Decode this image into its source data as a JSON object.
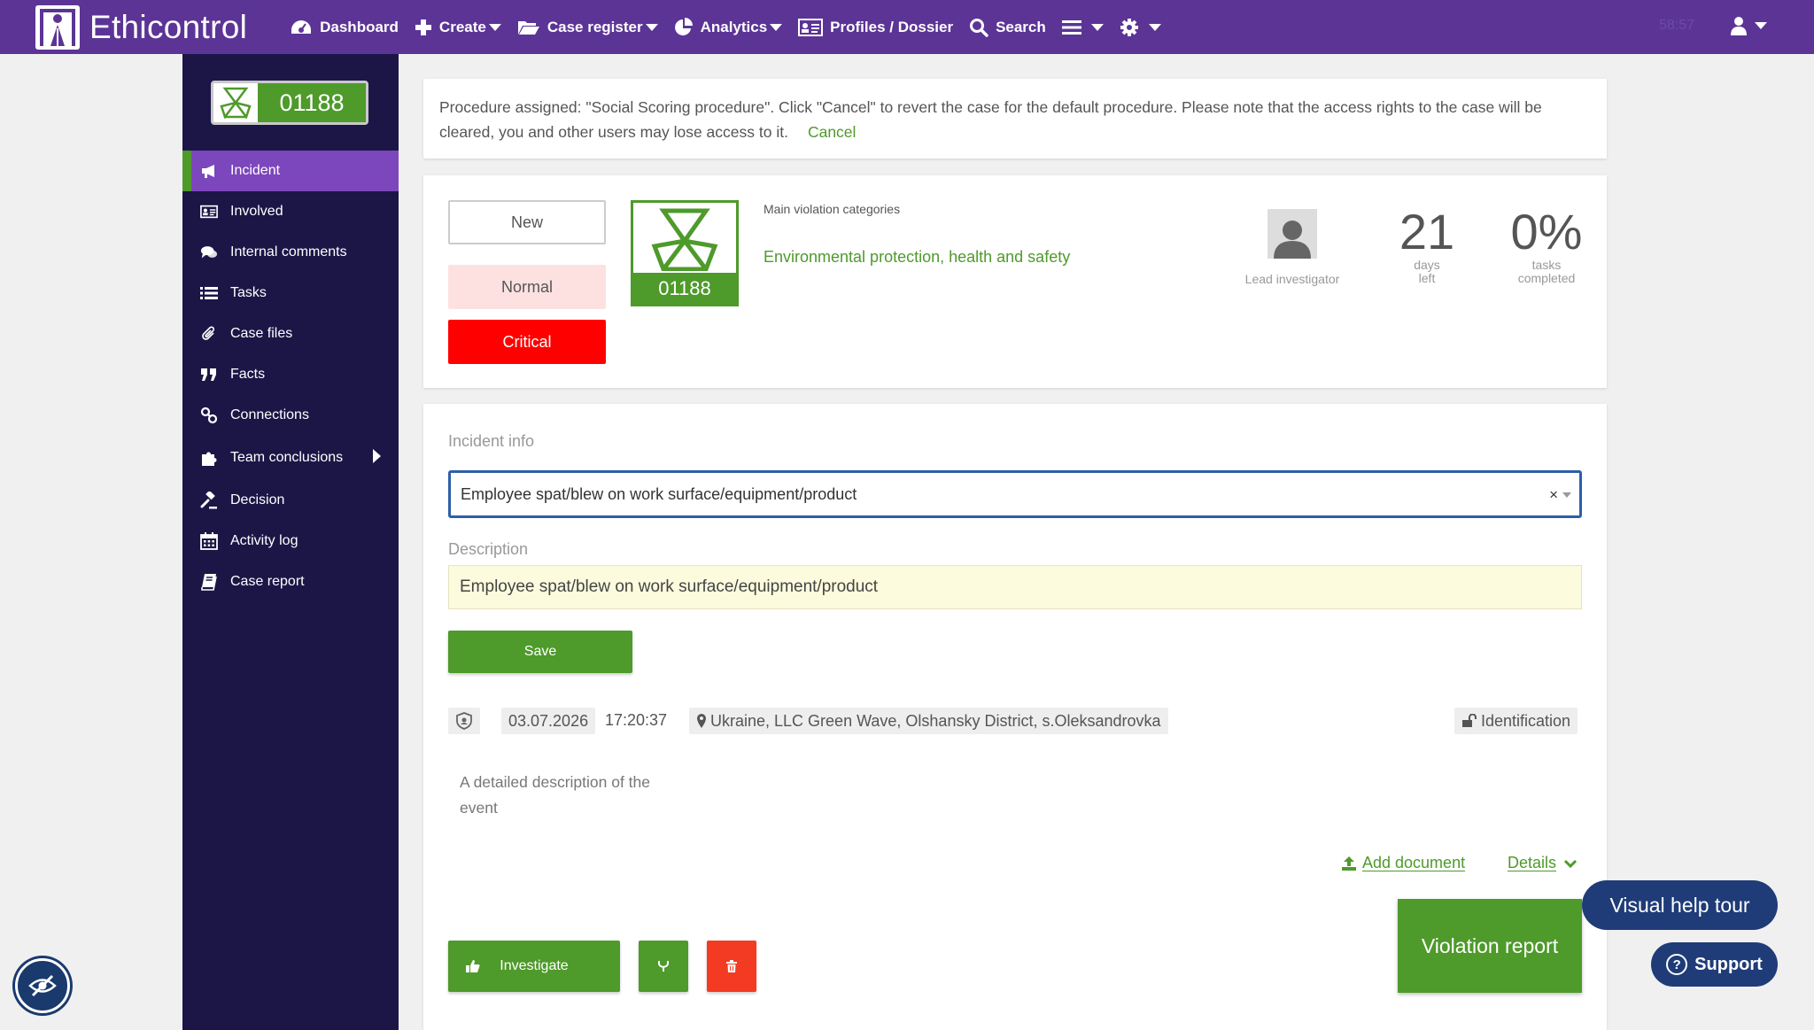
{
  "brand": {
    "name": "Ethicontrol"
  },
  "nav": {
    "items": [
      {
        "label": "Dashboard",
        "dropdown": false
      },
      {
        "label": "Create",
        "dropdown": true
      },
      {
        "label": "Case register",
        "dropdown": true
      },
      {
        "label": "Analytics",
        "dropdown": true
      },
      {
        "label": "Profiles / Dossier",
        "dropdown": false
      },
      {
        "label": "Search",
        "dropdown": false
      }
    ],
    "timer": "58:57"
  },
  "sidebar": {
    "case_number": "01188",
    "items": [
      {
        "label": "Incident",
        "icon": "megaphone-icon",
        "active": true
      },
      {
        "label": "Involved",
        "icon": "id-card-icon"
      },
      {
        "label": "Internal comments",
        "icon": "comments-icon"
      },
      {
        "label": "Tasks",
        "icon": "list-icon"
      },
      {
        "label": "Case files",
        "icon": "paperclip-icon"
      },
      {
        "label": "Facts",
        "icon": "quote-icon"
      },
      {
        "label": "Connections",
        "icon": "link-icon"
      },
      {
        "label": "Team conclusions",
        "icon": "puzzle-icon",
        "has_submenu": true
      },
      {
        "label": "Decision",
        "icon": "gavel-icon"
      },
      {
        "label": "Activity log",
        "icon": "calendar-icon"
      },
      {
        "label": "Case report",
        "icon": "book-icon"
      }
    ]
  },
  "notice": {
    "text": "Procedure assigned: \"Social Scoring procedure\". Click \"Cancel\" to revert the case for the default procedure. Please note that the access rights to the case will be cleared, you and other users may lose access to it.",
    "cancel_label": "Cancel"
  },
  "case": {
    "statuses": {
      "new": "New",
      "normal": "Normal",
      "critical": "Critical"
    },
    "number": "01188",
    "category_label": "Main violation categories",
    "category_value": "Environmental protection, health and safety",
    "investigator_label": "Lead investigator",
    "days_left": {
      "value": "21",
      "label_line1": "days",
      "label_line2": "left"
    },
    "tasks": {
      "value": "0%",
      "label_line1": "tasks",
      "label_line2": "completed"
    }
  },
  "incident": {
    "section_label": "Incident info",
    "select_value": "Employee spat/blew on work surface/equipment/product",
    "description_label": "Description",
    "description_value": "Employee spat/blew on work surface/equipment/product",
    "save_label": "Save",
    "date": "03.07.2026",
    "time": "17:20:37",
    "location": "Ukraine, LLC Green Wave, Olshansky District, s.Oleksandrovka",
    "identification_label": "Identification",
    "event_text": "A detailed description of the event",
    "add_document_label": "Add document",
    "details_label": "Details",
    "investigate_label": "Investigate",
    "violation_report_label": "Violation report"
  },
  "help": {
    "tour_label": "Visual help tour",
    "support_label": "Support"
  },
  "colors": {
    "purple": "#5c3496",
    "sidebar": "#1c1647",
    "green": "#4e9a2b",
    "red": "#ff0000",
    "navy": "#1f3c78"
  }
}
